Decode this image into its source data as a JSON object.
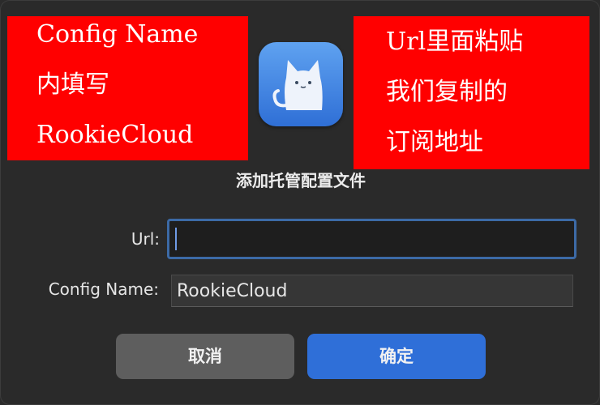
{
  "annotations": {
    "left": [
      "Config Name",
      "内填写",
      "RookieCloud"
    ],
    "right": [
      "Url里面粘贴",
      "我们复制的",
      "订阅地址"
    ],
    "color": "#ff0000"
  },
  "app_icon": "cat-icon",
  "dialog": {
    "title": "添加托管配置文件",
    "url_label": "Url:",
    "url_value": "",
    "config_label": "Config Name:",
    "config_value": "RookieCloud",
    "cancel_label": "取消",
    "confirm_label": "确定"
  },
  "colors": {
    "accent": "#2f6fd8",
    "focus_ring": "#3c6aa6",
    "background": "#2a2a2a"
  }
}
